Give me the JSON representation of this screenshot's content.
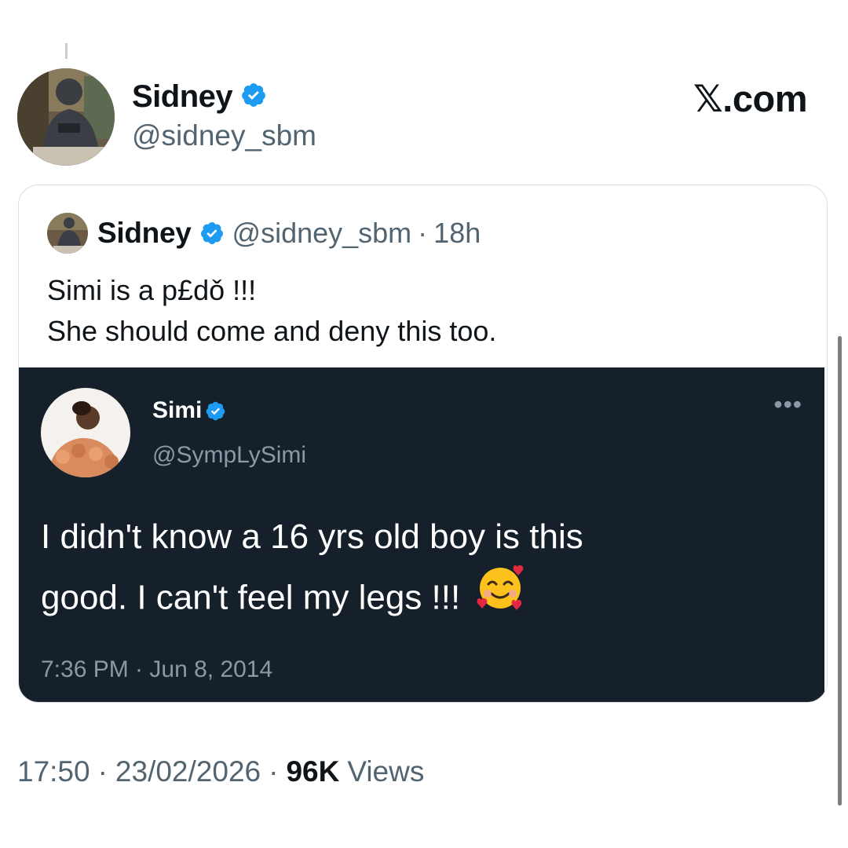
{
  "post": {
    "author_name": "Sidney",
    "author_handle": "@sidney_sbm",
    "verified_icon": "verified-badge-icon",
    "time": "17:50",
    "date": "23/02/2026",
    "separator": "·",
    "views_count": "96K",
    "views_label": "Views"
  },
  "brand": {
    "x_glyph": "𝕏",
    "domain": ".com"
  },
  "quoted": {
    "author_name": "Sidney",
    "author_handle": "@sidney_sbm",
    "separator": "·",
    "age": "18h",
    "text_lines": [
      "Simi is a p£dǒ !!!",
      "She should come and deny this too."
    ]
  },
  "screenshot": {
    "author_name": "Simi",
    "author_handle": "@SympLySimi",
    "more_icon": "more-options-icon",
    "text_lines": [
      "I didn't know a 16 yrs old boy is this",
      "good. I can't feel my legs !!!"
    ],
    "emoji": "smiling-face-with-hearts-icon",
    "timestamp": "7:36 PM · Jun 8, 2014"
  },
  "colors": {
    "verified_blue": "#1d9bf0",
    "dark_bg": "#15202b",
    "secondary_text": "#536471"
  }
}
